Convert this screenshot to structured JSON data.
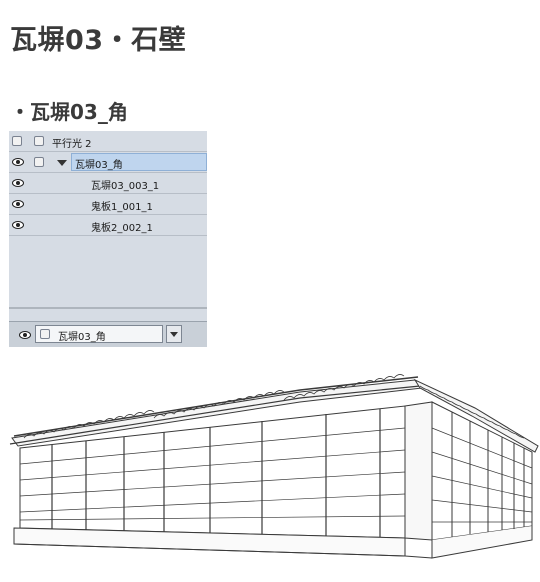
{
  "page": {
    "title": "瓦塀03・石壁",
    "section_title": "・瓦塀03_角"
  },
  "layer_panel": {
    "rows": [
      {
        "label": "平行光 2",
        "visible": false,
        "expanded": false,
        "selected": false
      },
      {
        "label": "瓦塀03_角",
        "visible": true,
        "expanded": true,
        "selected": true
      },
      {
        "label": "瓦塀03_003_1",
        "visible": true,
        "expanded": false,
        "selected": false
      },
      {
        "label": "鬼板1_001_1",
        "visible": true,
        "expanded": false,
        "selected": false
      },
      {
        "label": "鬼板2_002_1",
        "visible": true,
        "expanded": false,
        "selected": false
      }
    ],
    "footer": {
      "current_layer": "瓦塀03_角"
    }
  },
  "icons": {
    "eye": "eye-icon",
    "checkbox": "checkbox-icon",
    "expand": "expand-triangle-icon",
    "dropdown": "dropdown-arrow-icon"
  },
  "colors": {
    "panel_bg": "#d6dce4",
    "selection": "#bfd5ee",
    "title_text": "#3a3a3a"
  }
}
